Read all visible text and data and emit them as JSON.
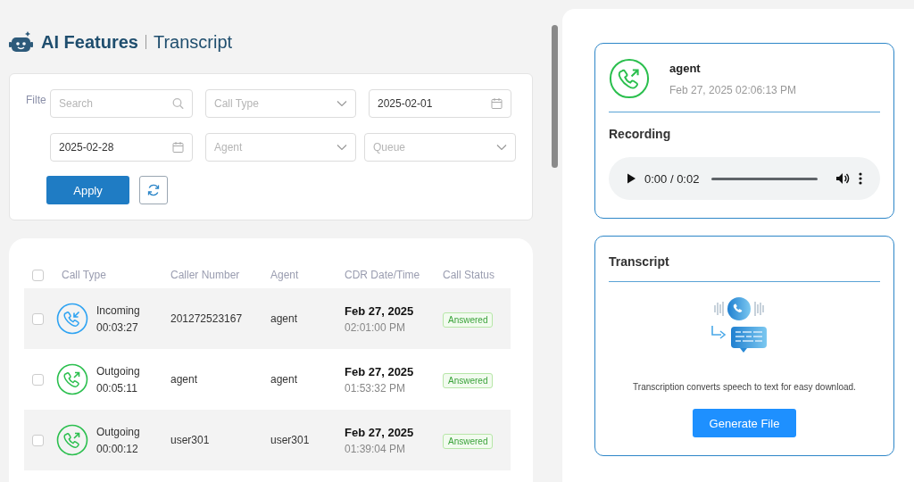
{
  "header": {
    "title": "AI Features",
    "subtitle": "Transcript"
  },
  "filters": {
    "label": "Filte",
    "search": {
      "placeholder": "Search"
    },
    "call_type": {
      "placeholder": "Call Type"
    },
    "date_from": {
      "value": "2025-02-01"
    },
    "date_to": {
      "value": "2025-02-28"
    },
    "agent": {
      "placeholder": "Agent"
    },
    "queue": {
      "placeholder": "Queue"
    },
    "apply": "Apply"
  },
  "table": {
    "select_all_checked": false,
    "columns": [
      "Call Type",
      "Caller Number",
      "Agent",
      "CDR Date/Time",
      "Call Status"
    ],
    "rows": [
      {
        "checked": false,
        "kind": "incoming",
        "call_type": "Incoming",
        "duration": "00:03:27",
        "caller": "201272523167",
        "agent": "agent",
        "date": "Feb 27, 2025",
        "time": "02:01:00 PM",
        "status": "Answered"
      },
      {
        "checked": false,
        "kind": "outgoing",
        "call_type": "Outgoing",
        "duration": "00:05:11",
        "caller": "agent",
        "agent": "agent",
        "date": "Feb 27, 2025",
        "time": "01:53:32 PM",
        "status": "Answered"
      },
      {
        "checked": false,
        "kind": "outgoing",
        "call_type": "Outgoing",
        "duration": "00:00:12",
        "caller": "user301",
        "agent": "user301",
        "date": "Feb 27, 2025",
        "time": "01:39:04 PM",
        "status": "Answered"
      }
    ]
  },
  "detail": {
    "kind": "outgoing",
    "name": "agent",
    "datetime": "Feb 27, 2025 02:06:13 PM",
    "recording_title": "Recording",
    "player_time": "0:00 / 0:02"
  },
  "transcript": {
    "title": "Transcript",
    "description": "Transcription converts speech to text for easy download.",
    "button": "Generate File"
  }
}
